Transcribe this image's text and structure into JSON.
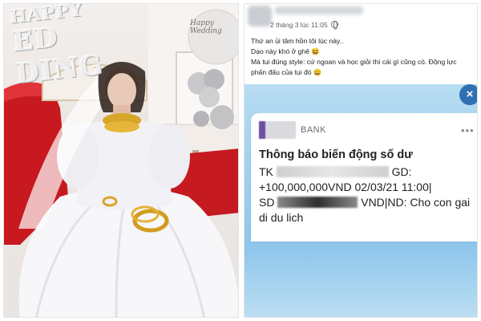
{
  "photo": {
    "banner_line1": "HAPPY",
    "banner_line2": "ED DING",
    "balloon_text": "Happy Wedding"
  },
  "post": {
    "time": "2 tháng 3 lúc 11:05",
    "caption_lines": [
      "Thứ an ủi tâm hồn tôi lúc này..",
      "Dạo này khó ở ghê 😆",
      "Mà tui đúng style: cứ ngoan và học giỏi thì cái gì cũng có. Động lực phấn đấu của tui đó 😄"
    ],
    "close_icon": "×",
    "notification": {
      "bank_name": "BANK",
      "more_icon": "•••",
      "title": "Thông báo biến động số dư",
      "line1_prefix": "TK",
      "line1_suffix": "GD:",
      "line2": "+100,000,000VND 02/03/21 11:00|",
      "line3_prefix": "SD",
      "line3_suffix": "VND|ND: Cho con gai",
      "line4": "di du lich"
    }
  },
  "colors": {
    "bank_area_blue": "#9fcfee",
    "close_button_blue": "#2f6fb3",
    "bank_logo_purple": "#6b4fa0"
  }
}
